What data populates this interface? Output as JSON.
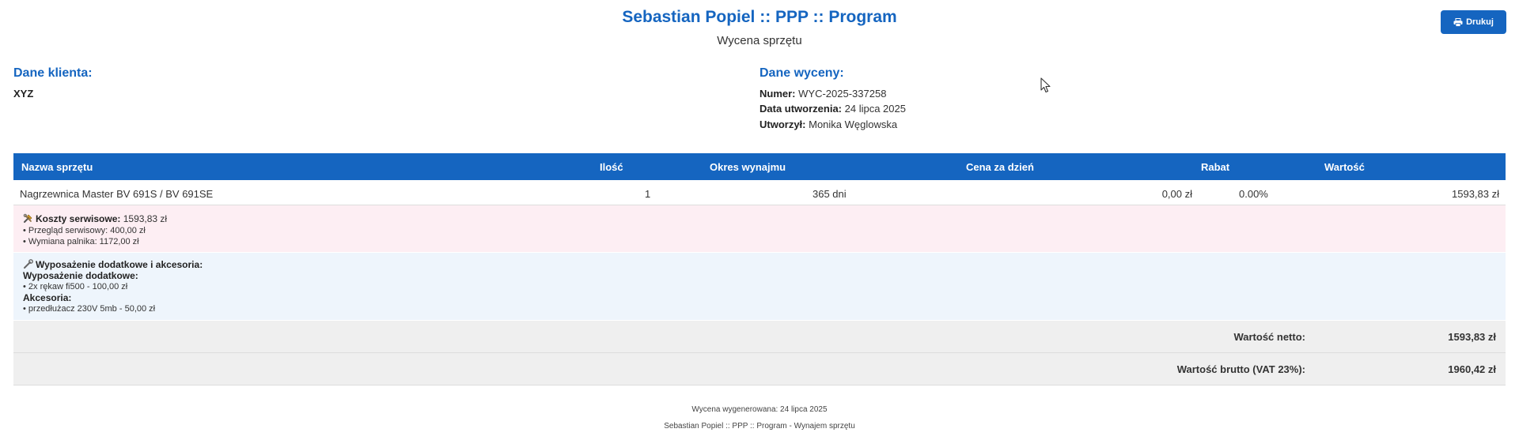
{
  "header": {
    "title": "Sebastian Popiel :: PPP :: Program",
    "subtitle": "Wycena sprzętu",
    "print_label": "Drukuj"
  },
  "client": {
    "heading": "Dane klienta:",
    "name": "XYZ"
  },
  "quote": {
    "heading": "Dane wyceny:",
    "number_label": "Numer:",
    "number": "WYC-2025-337258",
    "date_label": "Data utworzenia:",
    "date": "24 lipca 2025",
    "author_label": "Utworzył:",
    "author": "Monika Węglowska"
  },
  "table": {
    "headers": [
      "Nazwa sprzętu",
      "Ilość",
      "Okres wynajmu",
      "Cena za dzień",
      "Rabat",
      "Wartość"
    ],
    "row": {
      "name": "Nagrzewnica Master BV 691S / BV 691SE",
      "quantity": "1",
      "period": "365 dni",
      "price_per_day": "0,00 zł",
      "discount": "0.00%",
      "value": "1593,83 zł"
    }
  },
  "service": {
    "label": "Koszty serwisowe:",
    "total": "1593,83 zł",
    "items": [
      "• Przegląd serwisowy: 400,00 zł",
      "• Wymiana palnika: 1172,00 zł"
    ]
  },
  "equipment": {
    "title": "Wyposażenie dodatkowe i akcesoria:",
    "extra_label": "Wyposażenie dodatkowe:",
    "extra_items": [
      "• 2x rękaw fi500 - 100,00 zł"
    ],
    "accessories_label": "Akcesoria:",
    "accessories_items": [
      "• przedłużacz 230V 5mb - 50,00 zł"
    ]
  },
  "totals": {
    "net_label": "Wartość netto:",
    "net_value": "1593,83 zł",
    "gross_label": "Wartość brutto (VAT 23%):",
    "gross_value": "1960,42 zł"
  },
  "footer": {
    "generated": "Wycena wygenerowana: 24 lipca 2025",
    "brand": "Sebastian Popiel :: PPP :: Program - Wynajem sprzętu"
  },
  "colors": {
    "accent": "#1565c0",
    "service_bg": "#fdeef3",
    "equipment_bg": "#eef5fc",
    "totals_bg": "#efefef"
  }
}
